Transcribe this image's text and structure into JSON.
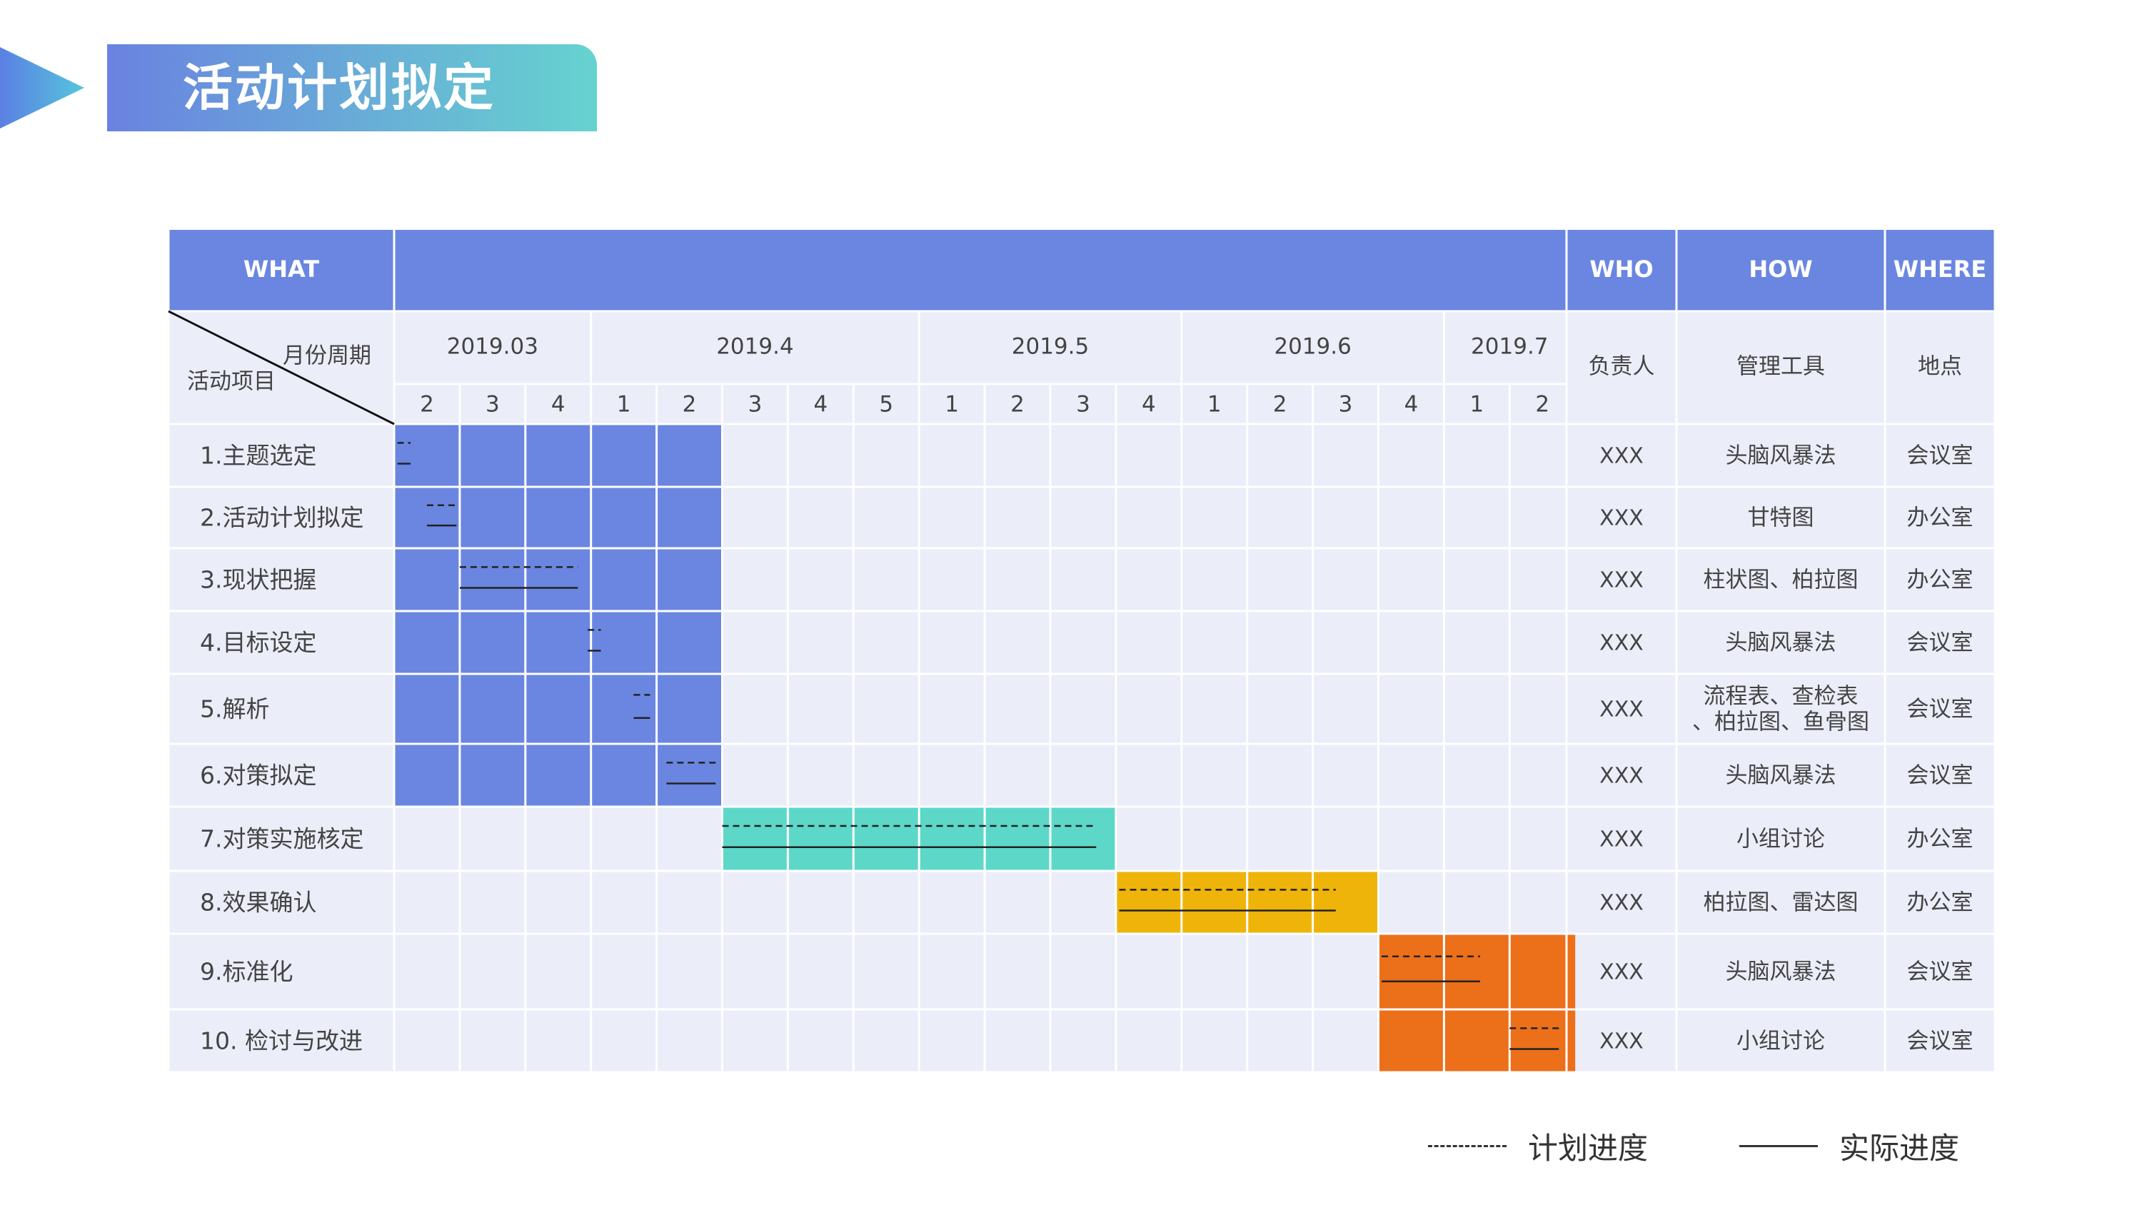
{
  "title": "活动计划拟定",
  "colors": {
    "header": "#6a86e0",
    "table_bg": "#ebedf9",
    "grid": "#ffffff",
    "blue": "#6a86e0",
    "teal": "#5dd8c8",
    "yellow": "#efb40a",
    "orange": "#ec6f1a",
    "line": "#222222"
  },
  "table": {
    "headers": {
      "what": "WHAT",
      "who": "WHO",
      "how": "HOW",
      "where": "WHERE"
    },
    "corner": {
      "top": "月份周期",
      "bottom": "活动项目"
    },
    "sub_headers": {
      "who": "负责人",
      "how": "管理工具",
      "where": "地点"
    }
  },
  "legend": {
    "plan": "计划进度",
    "actual": "实际进度"
  },
  "chart_data": {
    "type": "gantt",
    "months": [
      {
        "label": "2019.03",
        "weeks": [
          "2",
          "3",
          "4"
        ]
      },
      {
        "label": "2019.4",
        "weeks": [
          "1",
          "2",
          "3",
          "4",
          "5"
        ]
      },
      {
        "label": "2019.5",
        "weeks": [
          "1",
          "2",
          "3",
          "4"
        ]
      },
      {
        "label": "2019.6",
        "weeks": [
          "1",
          "2",
          "3",
          "4"
        ]
      },
      {
        "label": "2019.7",
        "weeks": [
          "1",
          "2"
        ]
      }
    ],
    "rows": [
      {
        "name": "1.主题选定",
        "who": "XXX",
        "how": "头脑风暴法",
        "where": "会议室",
        "fill": {
          "start": 0,
          "end": 5,
          "color": "blue"
        },
        "plan": [
          0.05,
          0.25
        ],
        "actual": [
          0.05,
          0.25
        ]
      },
      {
        "name": "2.活动计划拟定",
        "who": "XXX",
        "how": "甘特图",
        "where": "办公室",
        "fill": {
          "start": 0,
          "end": 5,
          "color": "blue"
        },
        "plan": [
          0.5,
          0.95
        ],
        "actual": [
          0.5,
          0.95
        ]
      },
      {
        "name": "3.现状把握",
        "who": "XXX",
        "how": "柱状图、柏拉图",
        "where": "办公室",
        "fill": {
          "start": 0,
          "end": 5,
          "color": "blue"
        },
        "plan": [
          1.0,
          2.8
        ],
        "actual": [
          1.0,
          2.8
        ]
      },
      {
        "name": "4.目标设定",
        "who": "XXX",
        "how": "头脑风暴法",
        "where": "会议室",
        "fill": {
          "start": 0,
          "end": 5,
          "color": "blue"
        },
        "plan": [
          2.95,
          3.15
        ],
        "actual": [
          2.95,
          3.15
        ]
      },
      {
        "name": "5.解析",
        "who": "XXX",
        "how": "流程表、查检表、柏拉图、鱼骨图",
        "where": "会议室",
        "fill": {
          "start": 0,
          "end": 5,
          "color": "blue"
        },
        "plan": [
          3.65,
          3.9
        ],
        "actual": [
          3.65,
          3.9
        ]
      },
      {
        "name": "6.对策拟定",
        "who": "XXX",
        "how": "头脑风暴法",
        "where": "会议室",
        "fill": {
          "start": 0,
          "end": 5,
          "color": "blue"
        },
        "plan": [
          4.15,
          4.9
        ],
        "actual": [
          4.15,
          4.9
        ]
      },
      {
        "name": "7.对策实施核定",
        "who": "XXX",
        "how": "小组讨论",
        "where": "办公室",
        "fill": {
          "start": 5,
          "end": 11,
          "color": "teal"
        },
        "plan": [
          5.0,
          10.7
        ],
        "actual": [
          5.0,
          10.7
        ]
      },
      {
        "name": "8.效果确认",
        "who": "XXX",
        "how": "柏拉图、雷达图",
        "where": "办公室",
        "fill": {
          "start": 11,
          "end": 15,
          "color": "yellow"
        },
        "plan": [
          11.05,
          14.35
        ],
        "actual": [
          11.05,
          14.35
        ]
      },
      {
        "name": "9.标准化",
        "who": "XXX",
        "how": "头脑风暴法",
        "where": "会议室",
        "fill": {
          "start": 15,
          "end": 18,
          "color": "orange"
        },
        "plan": [
          15.05,
          16.55
        ],
        "actual": [
          15.05,
          16.55
        ]
      },
      {
        "name": "10. 检讨与改进",
        "who": "XXX",
        "how": "小组讨论",
        "where": "会议室",
        "fill": {
          "start": 15,
          "end": 18,
          "color": "orange"
        },
        "plan": [
          17.0,
          17.75
        ],
        "actual": [
          17.0,
          17.75
        ]
      }
    ]
  }
}
